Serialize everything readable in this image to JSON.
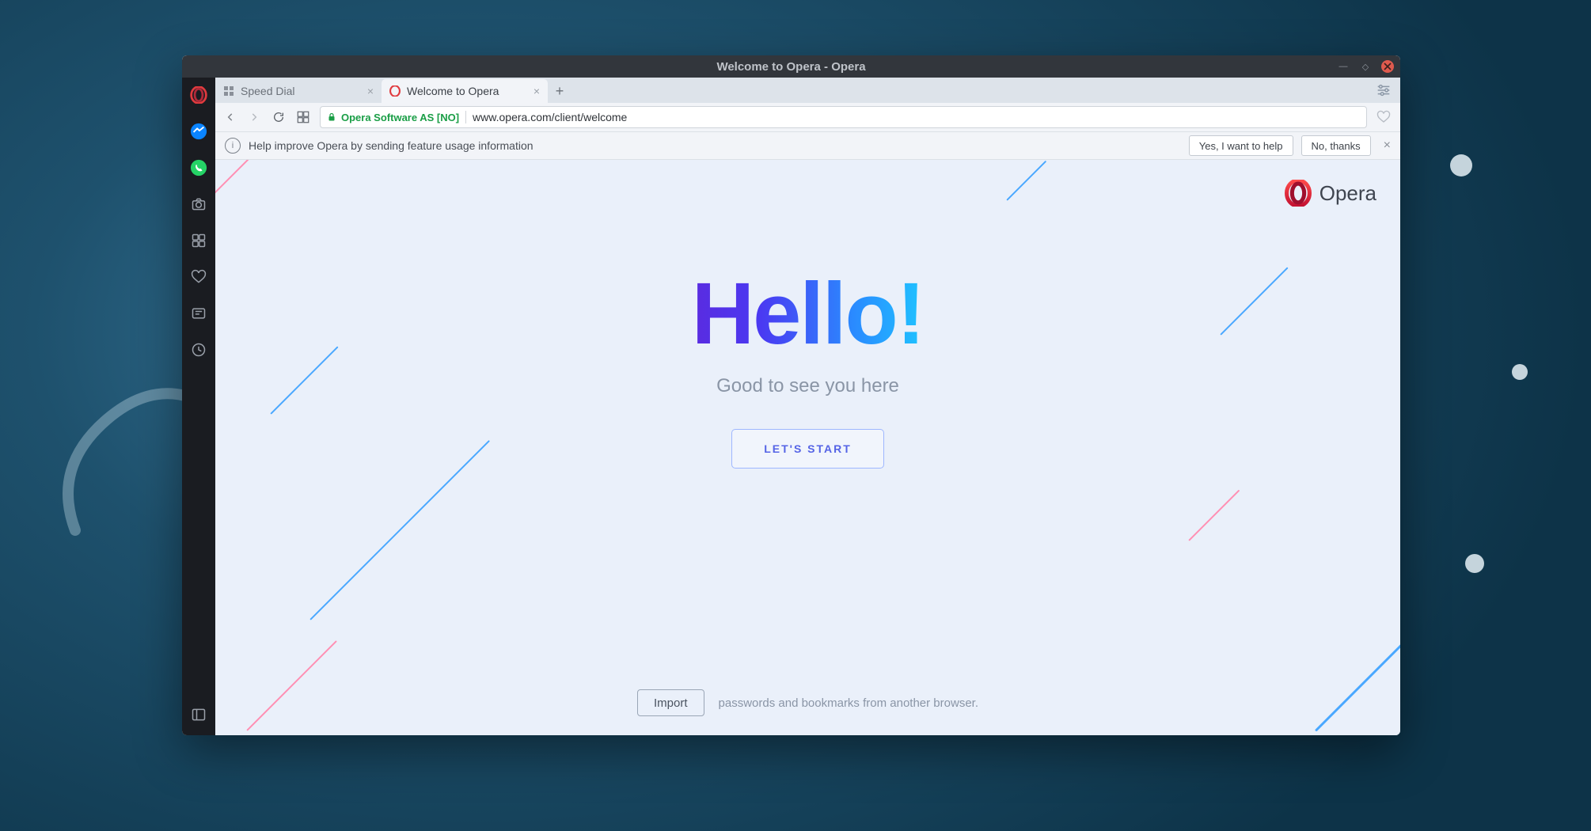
{
  "window": {
    "title": "Welcome to Opera - Opera"
  },
  "tabs": [
    {
      "label": "Speed Dial",
      "active": false
    },
    {
      "label": "Welcome to Opera",
      "active": true
    }
  ],
  "address_bar": {
    "cert_label": "Opera Software AS [NO]",
    "url": "www.opera.com/client/welcome"
  },
  "infobar": {
    "message": "Help improve Opera by sending feature usage information",
    "accept_label": "Yes, I want to help",
    "decline_label": "No, thanks"
  },
  "sidebar": {
    "icons": [
      "opera",
      "messenger",
      "whatsapp",
      "snapshot",
      "extensions",
      "bookmarks",
      "personal-news",
      "history"
    ]
  },
  "page": {
    "brand_label": "Opera",
    "hello": "Hello!",
    "subtitle": "Good to see you here",
    "start_label": "LET'S START",
    "import_label": "Import",
    "import_text": "passwords and bookmarks from another browser."
  }
}
